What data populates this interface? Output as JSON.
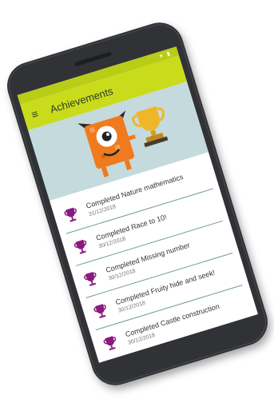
{
  "app": {
    "title": "Achievements",
    "colors": {
      "accent": "#c9dc1c",
      "hero_bg": "#c4dadc",
      "trophy": "#8a1a7e",
      "mascot": "#f07a1e"
    }
  },
  "header": {
    "menu_icon": "hamburger-menu-icon",
    "hero_image": "monster-with-trophy"
  },
  "achievements": [
    {
      "title": "Completed Nature mathematics",
      "date": "31/12/2018"
    },
    {
      "title": "Completed Race to 10!",
      "date": "30/12/2018"
    },
    {
      "title": "Completed Missing number",
      "date": "30/12/2018"
    },
    {
      "title": "Completed Fruity hide and seek!",
      "date": "30/12/2018"
    },
    {
      "title": "Completed Castle construction",
      "date": "30/12/2018"
    }
  ]
}
